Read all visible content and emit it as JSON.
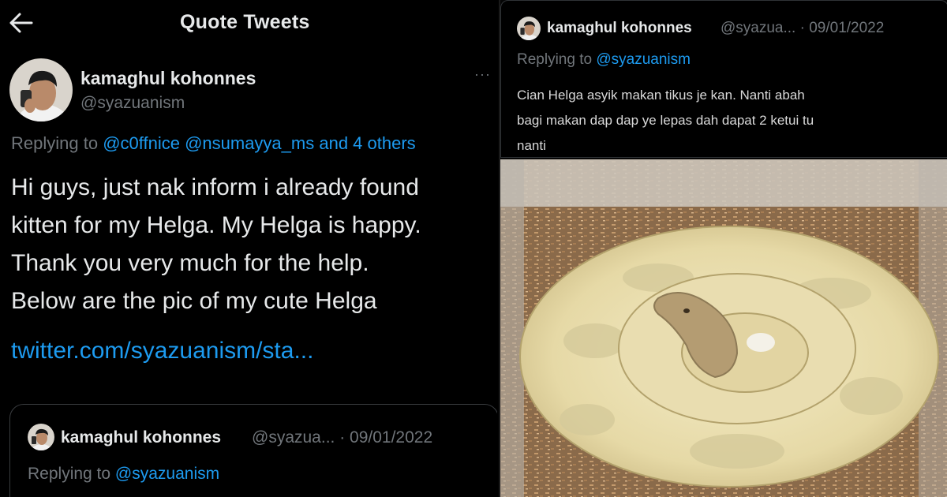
{
  "header": {
    "title": "Quote Tweets",
    "back_icon": "arrow-left-icon"
  },
  "main_tweet": {
    "author_name": "kamaghul kohonnes",
    "author_handle": "@syazuanism",
    "more_icon": "more-dots-icon",
    "reply_prefix": "Replying to",
    "reply_targets": "@c0ffnice @nsumayya_ms and 4 others",
    "text_lines": [
      "Hi guys, just nak inform i already found",
      "kitten for my Helga. My Helga is happy.",
      "Thank you very much for the help.",
      "Below are the pic of my cute Helga"
    ],
    "link": "twitter.com/syazuanism/sta..."
  },
  "quoted_tweet": {
    "author_name": "kamaghul kohonnes",
    "meta": "@syazua... · 09/01/2022",
    "reply_prefix": "Replying to",
    "reply_target": "@syazuanism"
  },
  "right_tweet": {
    "author_name": "kamaghul kohonnes",
    "meta": "@syazua... · 09/01/2022",
    "reply_prefix": "Replying to",
    "reply_target": "@syazuanism",
    "text_lines": [
      "Cian Helga asyik makan tikus je kan. Nanti abah",
      "bagi makan dap dap ye lepas dah dapat 2 ketui tu",
      "nanti"
    ],
    "image": "snake-photo"
  },
  "colors": {
    "background": "#000000",
    "text": "#e7e9ea",
    "muted": "#71767b",
    "link": "#1d9bf0"
  }
}
